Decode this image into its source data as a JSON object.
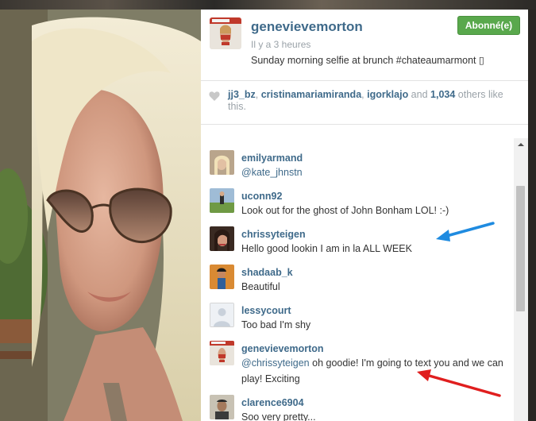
{
  "post": {
    "username": "genevievemorton",
    "time": "Il y a 3 heures",
    "caption": "Sunday morning selfie at brunch #chateaumarmont ▯",
    "follow_label": "Abonné(e)"
  },
  "likes": {
    "users": [
      "jj3_bz",
      "cristinamariamiranda",
      "igorklajo"
    ],
    "sep1": ", ",
    "sep2": ", ",
    "and": " and ",
    "count": "1,034",
    "suffix": " others like this."
  },
  "comments": [
    {
      "user": "emilyarmand",
      "text": "@kate_jhnstn"
    },
    {
      "user": "uconn92",
      "text": "Look out for the ghost of John Bonham LOL! :-)"
    },
    {
      "user": "chrissyteigen",
      "text": "Hello good lookin I am in la ALL WEEK"
    },
    {
      "user": "shadaab_k",
      "text": "Beautiful"
    },
    {
      "user": "lessycourt",
      "text": "Too bad I'm shy"
    },
    {
      "user": "genevievemorton",
      "mention": "@chrissyteigen",
      "text": " oh goodie! I'm going to text you and we can play! Exciting"
    },
    {
      "user": "clarence6904",
      "text": "Soo very pretty..."
    }
  ],
  "colors": {
    "username": "#3f6a8a",
    "follow_green": "#59a84c",
    "arrow_blue": "#1f8be0",
    "arrow_red": "#e01e1e"
  },
  "icons": [
    "heart-icon",
    "scroll-up-icon"
  ]
}
